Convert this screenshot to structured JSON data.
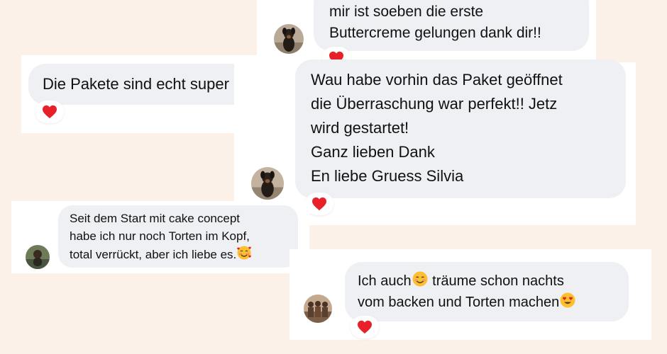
{
  "messages": [
    {
      "id": "m1",
      "lines": [
        "mir ist soeben die erste",
        "Buttercreme gelungen dank dir!!"
      ],
      "reaction": "heart-icon"
    },
    {
      "id": "m2",
      "lines": [
        "Die Pakete sind echt super"
      ],
      "reaction": "heart-icon"
    },
    {
      "id": "m3",
      "lines": [
        "Wau habe vorhin das Paket geöffnet",
        "die Überraschung war perfekt!! Jetz",
        "wird gestartet!",
        "Ganz lieben Dank",
        "En liebe Gruess Silvia"
      ],
      "reaction": "heart-icon"
    },
    {
      "id": "m4",
      "lines": [
        "Seit dem Start mit cake concept",
        "habe ich nur noch Torten im Kopf,",
        "total verrückt, aber ich liebe es."
      ],
      "trailing_emoji": "smiling-face-with-hearts-emoji"
    },
    {
      "id": "m5",
      "line1_before": "Ich auch",
      "line1_emoji": "smiling-face-emoji",
      "line1_after": " träume schon nachts",
      "line2": "vom backen und Torten machen",
      "line2_emoji": "heart-eyes-emoji",
      "reaction": "heart-icon"
    }
  ],
  "colors": {
    "page_background": "#fbf1e9",
    "card_background": "#ffffff",
    "bubble_background": "#eef0f3",
    "reaction_heart": "#e8202a",
    "text": "#111111"
  }
}
